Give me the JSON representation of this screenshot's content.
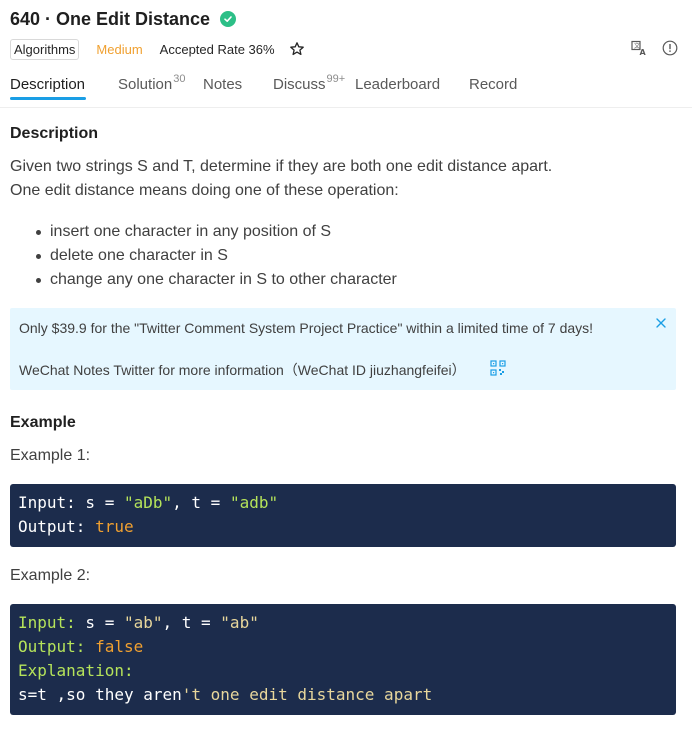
{
  "problem": {
    "title": "640 · One Edit Distance",
    "tag": "Algorithms",
    "difficulty": "Medium",
    "accepted_rate": "Accepted Rate 36%"
  },
  "tabs": [
    {
      "label": "Description",
      "badge": ""
    },
    {
      "label": "Solution",
      "badge": "30"
    },
    {
      "label": "Notes",
      "badge": ""
    },
    {
      "label": "Discuss",
      "badge": "99+"
    },
    {
      "label": "Leaderboard",
      "badge": ""
    },
    {
      "label": "Record",
      "badge": ""
    }
  ],
  "description": {
    "heading": "Description",
    "line1": "Given two strings S and T, determine if they are both one edit distance apart.",
    "line2": "One edit distance means doing one of these operation:",
    "operations": [
      "insert one character in any position of S",
      "delete one character in S",
      "change any one character in S to other character"
    ]
  },
  "promo": {
    "line1": "Only $39.9 for the \"Twitter Comment System Project Practice\" within a limited time of 7 days!",
    "line2": "WeChat Notes Twitter for more information（WeChat ID jiuzhangfeifei）"
  },
  "example": {
    "heading": "Example",
    "ex1": {
      "label": "Example 1:",
      "input_key": "Input:",
      "s_eq": " s = ",
      "s_val": "\"aDb\"",
      "t_eq": ", t = ",
      "t_val": "\"adb\"",
      "output_key": "Output:",
      "output_val": " true"
    },
    "ex2": {
      "label": "Example 2:",
      "input_key": "Input:",
      "s_eq": " s = ",
      "s_val": "\"ab\"",
      "t_eq": ", t = ",
      "t_val": "\"ab\"",
      "output_key": "Output:",
      "output_val": " false",
      "explanation_key": "Explanation:",
      "expl_a": "s=t ,so they aren",
      "expl_b": "'t one edit distance apart"
    }
  },
  "colors": {
    "accent": "#1a9ee5",
    "success": "#2cbf87",
    "medium": "#f0a030",
    "code_bg": "#1c2c4c",
    "promo_bg": "#e6f7ff"
  },
  "icons": [
    "check-circle-icon",
    "star-icon",
    "translate-icon",
    "info-icon",
    "close-icon",
    "qr-code-icon"
  ]
}
